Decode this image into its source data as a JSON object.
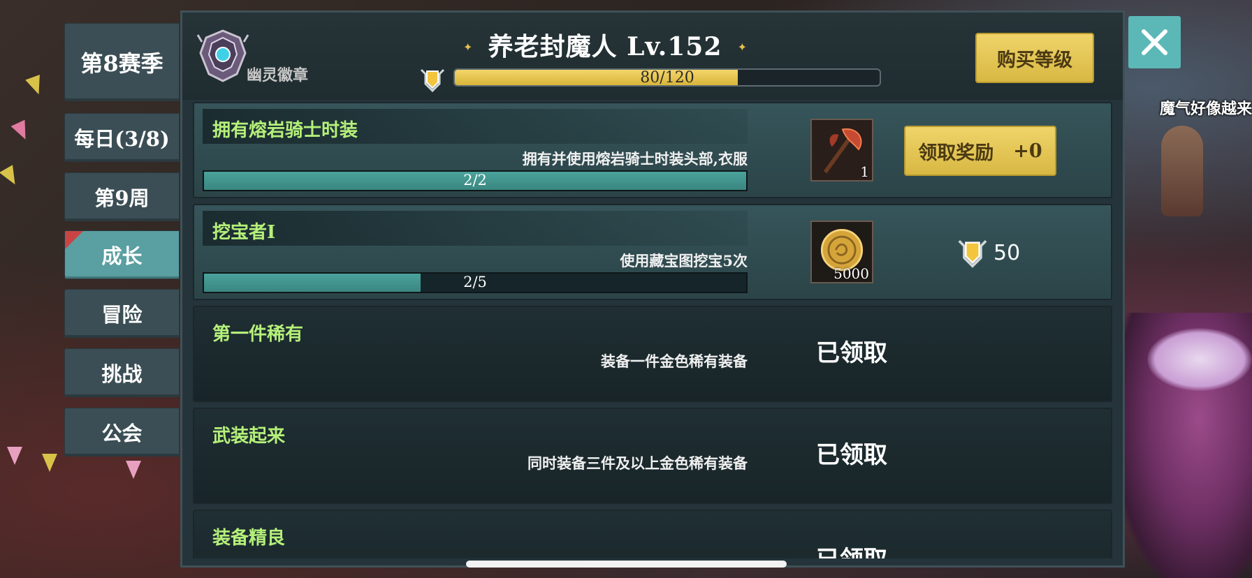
{
  "world": {
    "npc_speech": "魔气好像越来"
  },
  "tabs": [
    {
      "label": "第8赛季",
      "active": false
    },
    {
      "label": "每日(3/8)",
      "active": false
    },
    {
      "label": "第9周",
      "active": false
    },
    {
      "label": "成长",
      "active": true
    },
    {
      "label": "冒险",
      "active": false
    },
    {
      "label": "挑战",
      "active": false
    },
    {
      "label": "公会",
      "active": false
    }
  ],
  "header": {
    "badge_label": "幽灵徽章",
    "title": "养老封魔人 Lv.152",
    "xp": {
      "current": 80,
      "max": 120,
      "text": "80/120"
    },
    "buy_level_label": "购买等级"
  },
  "quests": [
    {
      "name": "拥有熔岩骑士时装",
      "desc": "拥有并使用熔岩骑士时装头部,衣服",
      "progress_text": "2/2",
      "progress": 1.0,
      "item": {
        "icon": "lava-axe-icon",
        "count": "1"
      },
      "claim": {
        "label": "领取奖励",
        "bonus": "+0"
      }
    },
    {
      "name": "挖宝者I",
      "desc": "使用藏宝图挖宝5次",
      "progress_text": "2/5",
      "progress": 0.4,
      "item": {
        "icon": "gold-coin-icon",
        "count": "5000"
      },
      "reward": {
        "icon": "shield-point-icon",
        "value": "50"
      }
    },
    {
      "name": "第一件稀有",
      "desc": "装备一件金色稀有装备",
      "status": "已领取"
    },
    {
      "name": "武装起来",
      "desc": "同时装备三件及以上金色稀有装备",
      "status": "已领取"
    },
    {
      "name": "装备精良",
      "desc": "",
      "status": "已领取"
    }
  ]
}
